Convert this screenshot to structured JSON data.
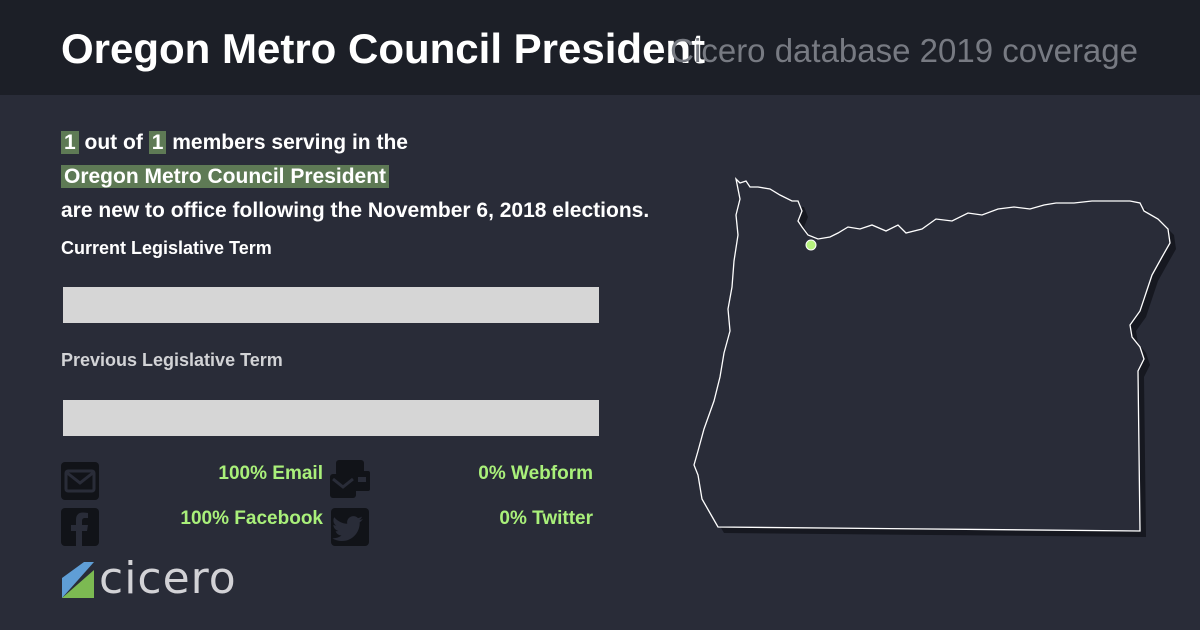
{
  "header": {
    "title": "Oregon Metro Council President",
    "coverage": "Cicero database 2019 coverage"
  },
  "summary": {
    "new_count": "1",
    "out_of": "out of",
    "total_count": "1",
    "members_text": "members serving in the",
    "body_name": "Oregon Metro Council President",
    "tail_text": "are new to office following the November 6, 2018 elections."
  },
  "terms": {
    "current_label": "Current Legislative Term",
    "current_fill_fraction": 0,
    "previous_label": "Previous Legislative Term",
    "previous_fill_fraction": 0
  },
  "stats": {
    "email": "100% Email",
    "webform": "0% Webform",
    "facebook": "100% Facebook",
    "twitter": "0% Twitter",
    "icons": [
      "envelope-icon",
      "webform-icon",
      "facebook-icon",
      "twitter-icon"
    ]
  },
  "logo": {
    "text": "cicero"
  },
  "map": {
    "state": "Oregon",
    "marker": "Portland"
  },
  "colors": {
    "background": "#292c38",
    "header": "#1c1f27",
    "highlight": "#5e7a55",
    "accent": "#a9f07a",
    "bar": "#d6d6d6"
  }
}
